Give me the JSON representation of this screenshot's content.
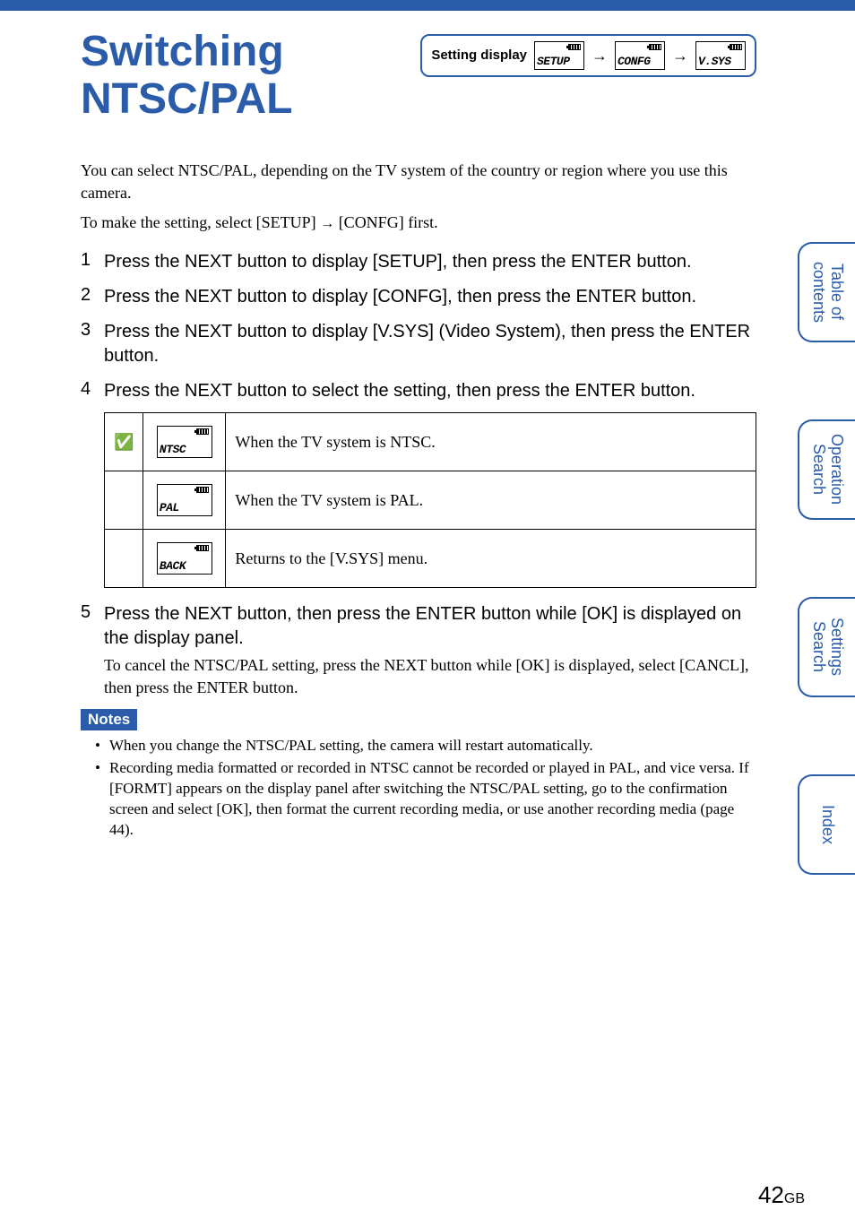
{
  "title": "Switching NTSC/PAL",
  "setting_display": {
    "label": "Setting display",
    "step1": "SETUP",
    "step2": "CONFG",
    "step3": "V.SYS"
  },
  "intro": {
    "p1": "You can select NTSC/PAL, depending on the TV system of the country or region where you use this camera.",
    "p2_a": "To make the setting, select [SETUP] ",
    "p2_b": " [CONFG] first."
  },
  "steps": {
    "s1": "Press the NEXT button to display [SETUP], then press the ENTER button.",
    "s2": "Press the NEXT button to display [CONFG], then press the ENTER button.",
    "s3": "Press the NEXT button to display [V.SYS] (Video System), then press the ENTER button.",
    "s4": "Press the NEXT button to select the setting, then press the ENTER button.",
    "s5_main": "Press the NEXT button, then press the ENTER button while [OK] is displayed on the display panel.",
    "s5_sub": "To cancel the NTSC/PAL setting, press the NEXT button while [OK] is displayed, select [CANCL], then press the ENTER button."
  },
  "options": {
    "r1": {
      "lcd": "NTSC",
      "desc": "When the TV system is NTSC."
    },
    "r2": {
      "lcd": "PAL",
      "desc": "When the TV system is PAL."
    },
    "r3": {
      "lcd": "BACK",
      "desc": "Returns to the [V.SYS] menu."
    }
  },
  "notes": {
    "label": "Notes",
    "n1": "When you change the NTSC/PAL setting, the camera will restart automatically.",
    "n2": "Recording media formatted or recorded in NTSC cannot be recorded or played in PAL, and vice versa. If [FORMT] appears on the display panel after switching the NTSC/PAL setting, go to the confirmation screen and select [OK], then format the current recording media, or use another recording media (page 44)."
  },
  "side_tabs": {
    "t1": "Table of contents",
    "t2": "Operation Search",
    "t3": "Settings Search",
    "t4": "Index"
  },
  "page": {
    "num": "42",
    "suffix": "GB"
  }
}
